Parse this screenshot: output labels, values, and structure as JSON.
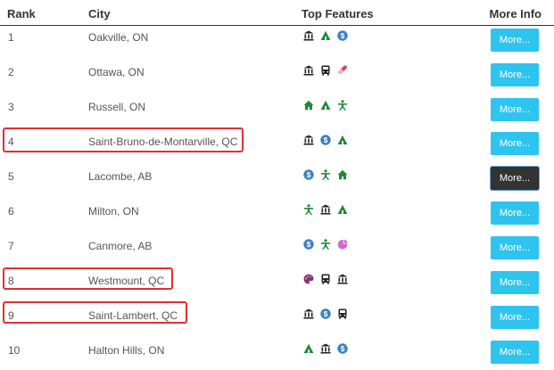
{
  "header": {
    "rank": "Rank",
    "city": "City",
    "features": "Top Features",
    "more": "More Info"
  },
  "rows": [
    {
      "rank": "1",
      "city": "Oakville, ON",
      "button": "More...",
      "icons": [
        "bank-icon",
        "tree-icon",
        "dollar-icon"
      ]
    },
    {
      "rank": "2",
      "city": "Ottawa, ON",
      "button": "More...",
      "icons": [
        "bank-icon",
        "bus-icon",
        "pill-icon"
      ]
    },
    {
      "rank": "3",
      "city": "Russell, ON",
      "button": "More...",
      "icons": [
        "house-icon",
        "tree-icon",
        "person-icon"
      ]
    },
    {
      "rank": "4",
      "city": "Saint-Bruno-de-Montarville, QC",
      "button": "More...",
      "icons": [
        "bank-icon",
        "dollar-icon",
        "tree-icon"
      ]
    },
    {
      "rank": "5",
      "city": "Lacombe, AB",
      "button": "More...",
      "icons": [
        "dollar-icon",
        "person-icon",
        "house-icon"
      ],
      "active": true
    },
    {
      "rank": "6",
      "city": "Milton, ON",
      "button": "More...",
      "icons": [
        "person-icon",
        "bank-icon",
        "tree-icon"
      ]
    },
    {
      "rank": "7",
      "city": "Canmore, AB",
      "button": "More...",
      "icons": [
        "dollar-icon",
        "person-icon",
        "pie-icon"
      ]
    },
    {
      "rank": "8",
      "city": "Westmount, QC",
      "button": "More...",
      "icons": [
        "palette-icon",
        "bus-icon",
        "bank-icon"
      ]
    },
    {
      "rank": "9",
      "city": "Saint-Lambert, QC",
      "button": "More...",
      "icons": [
        "bank-icon",
        "dollar-icon",
        "bus-icon"
      ]
    },
    {
      "rank": "10",
      "city": "Halton Hills, ON",
      "button": "More...",
      "icons": [
        "tree-icon",
        "bank-icon",
        "dollar-icon"
      ]
    }
  ],
  "highlighted_rows": [
    "4",
    "8",
    "9"
  ],
  "colors": {
    "button": "#2ec4f0",
    "button_active": "#333333",
    "highlight": "#e03030",
    "tree": "#1f8a3b",
    "dollar": "#3d7fc0",
    "pill": "#d9435a",
    "pie": "#d06ad0",
    "palette": "#8b2c7a",
    "dark": "#222222"
  }
}
